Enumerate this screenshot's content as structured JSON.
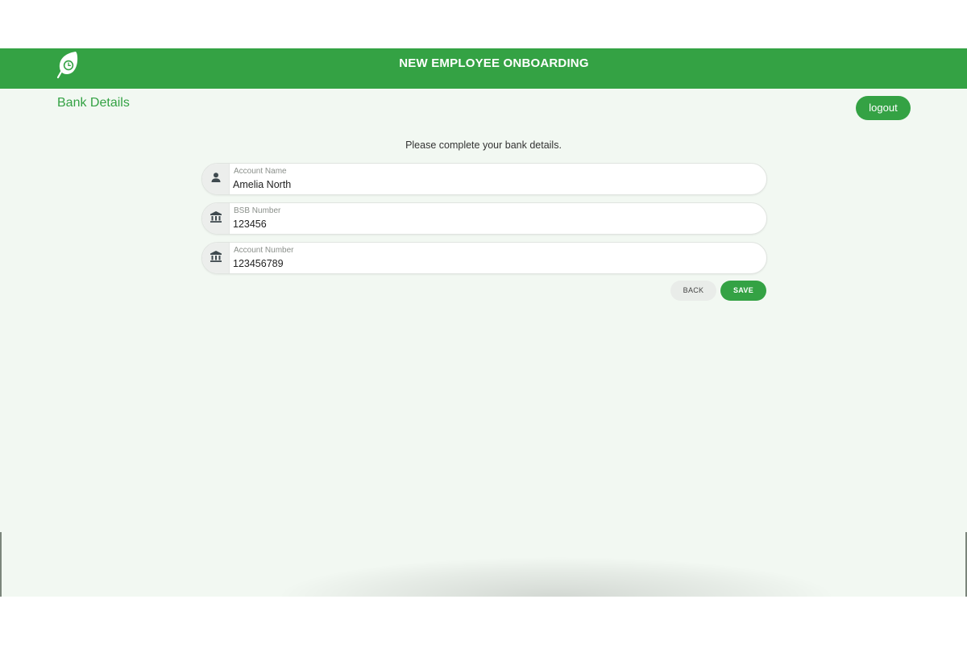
{
  "header": {
    "title": "NEW EMPLOYEE ONBOARDING",
    "logo_icon": "leaf-clock-icon"
  },
  "page": {
    "title": "Bank Details",
    "logout_label": "logout",
    "instructions": "Please complete your bank details."
  },
  "form": {
    "fields": [
      {
        "label": "Account Name",
        "value": "Amelia North",
        "icon": "person-icon"
      },
      {
        "label": "BSB Number",
        "value": "123456",
        "icon": "bank-icon"
      },
      {
        "label": "Account Number",
        "value": "123456789",
        "icon": "bank-icon"
      }
    ],
    "back_label": "BACK",
    "save_label": "SAVE"
  },
  "colors": {
    "brand_green": "#34a244",
    "background": "#f2f8f2",
    "text_dark": "#333333"
  }
}
